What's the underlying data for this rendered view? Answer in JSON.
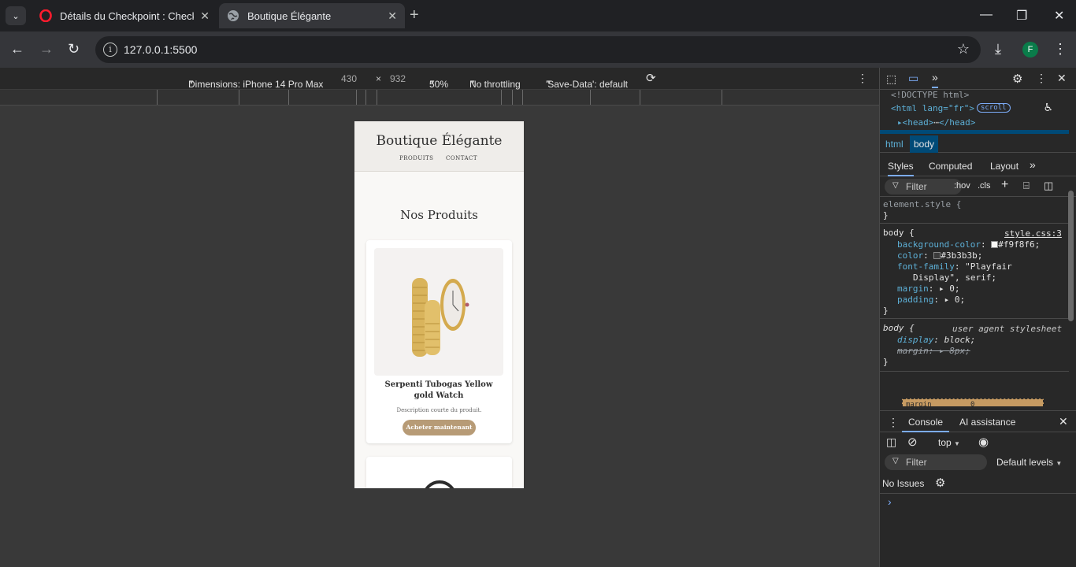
{
  "browser": {
    "tabs": [
      {
        "title": "Détails du Checkpoint : Checkpoint",
        "active": false,
        "icon": "opera-icon"
      },
      {
        "title": "Boutique Élégante",
        "active": true,
        "icon": "globe-icon"
      }
    ],
    "url": "127.0.0.1:5500",
    "profile_initial": "F",
    "colors": {
      "frame": "#202124",
      "toolbar": "#35363a",
      "avatar": "#0a7c4a"
    }
  },
  "device_toolbar": {
    "device": "Dimensions: iPhone 14 Pro Max",
    "width": "430",
    "times": "×",
    "height": "932",
    "zoom": "50%",
    "throttling": "No throttling",
    "save_data": "'Save-Data': default"
  },
  "site": {
    "title": "Boutique Élégante",
    "nav": [
      "PRODUITS",
      "CONTACT"
    ],
    "section_title": "Nos Produits",
    "products": [
      {
        "name": "Serpenti Tubogas Yellow gold Watch",
        "description": "Description courte du produit.",
        "button": "Acheter maintenant"
      }
    ],
    "colors": {
      "background": "#f9f8f6",
      "text": "#3b3b3b",
      "button": "#b79b76"
    }
  },
  "devtools": {
    "elements": {
      "doctype": "<!DOCTYPE html>",
      "html_open": "<html lang=\"fr\">",
      "scroll_badge": "scroll",
      "head_line": "<head>",
      "head_close": "</head>"
    },
    "breadcrumb": [
      "html",
      "body"
    ],
    "style_tabs": [
      "Styles",
      "Computed",
      "Layout"
    ],
    "filter_placeholder": "Filter",
    "hov": ":hov",
    "cls": ".cls",
    "rules": {
      "element_style": "element.style {",
      "close": "}",
      "body_selector": "body {",
      "body_source": "style.css:3",
      "props": [
        {
          "name": "background-color",
          "value": "#f9f8f6"
        },
        {
          "name": "color",
          "value": "#3b3b3b"
        },
        {
          "name": "font-family",
          "value": "\"Playfair"
        },
        {
          "name": "",
          "value": "Display\", serif;"
        },
        {
          "name": "margin",
          "value": "0;"
        },
        {
          "name": "padding",
          "value": "0;"
        }
      ],
      "ua_selector": "body {",
      "ua_source": "user agent stylesheet",
      "ua_props": [
        {
          "name": "display",
          "value": "block;"
        },
        {
          "name": "margin",
          "value": "8px;"
        }
      ]
    },
    "box_model_label": "margin",
    "box_model_value": "0",
    "drawer_tabs": [
      "Console",
      "AI assistance"
    ],
    "context": "top",
    "console_filter": "Filter",
    "levels": "Default levels",
    "issues": "No Issues",
    "prompt": "›"
  }
}
